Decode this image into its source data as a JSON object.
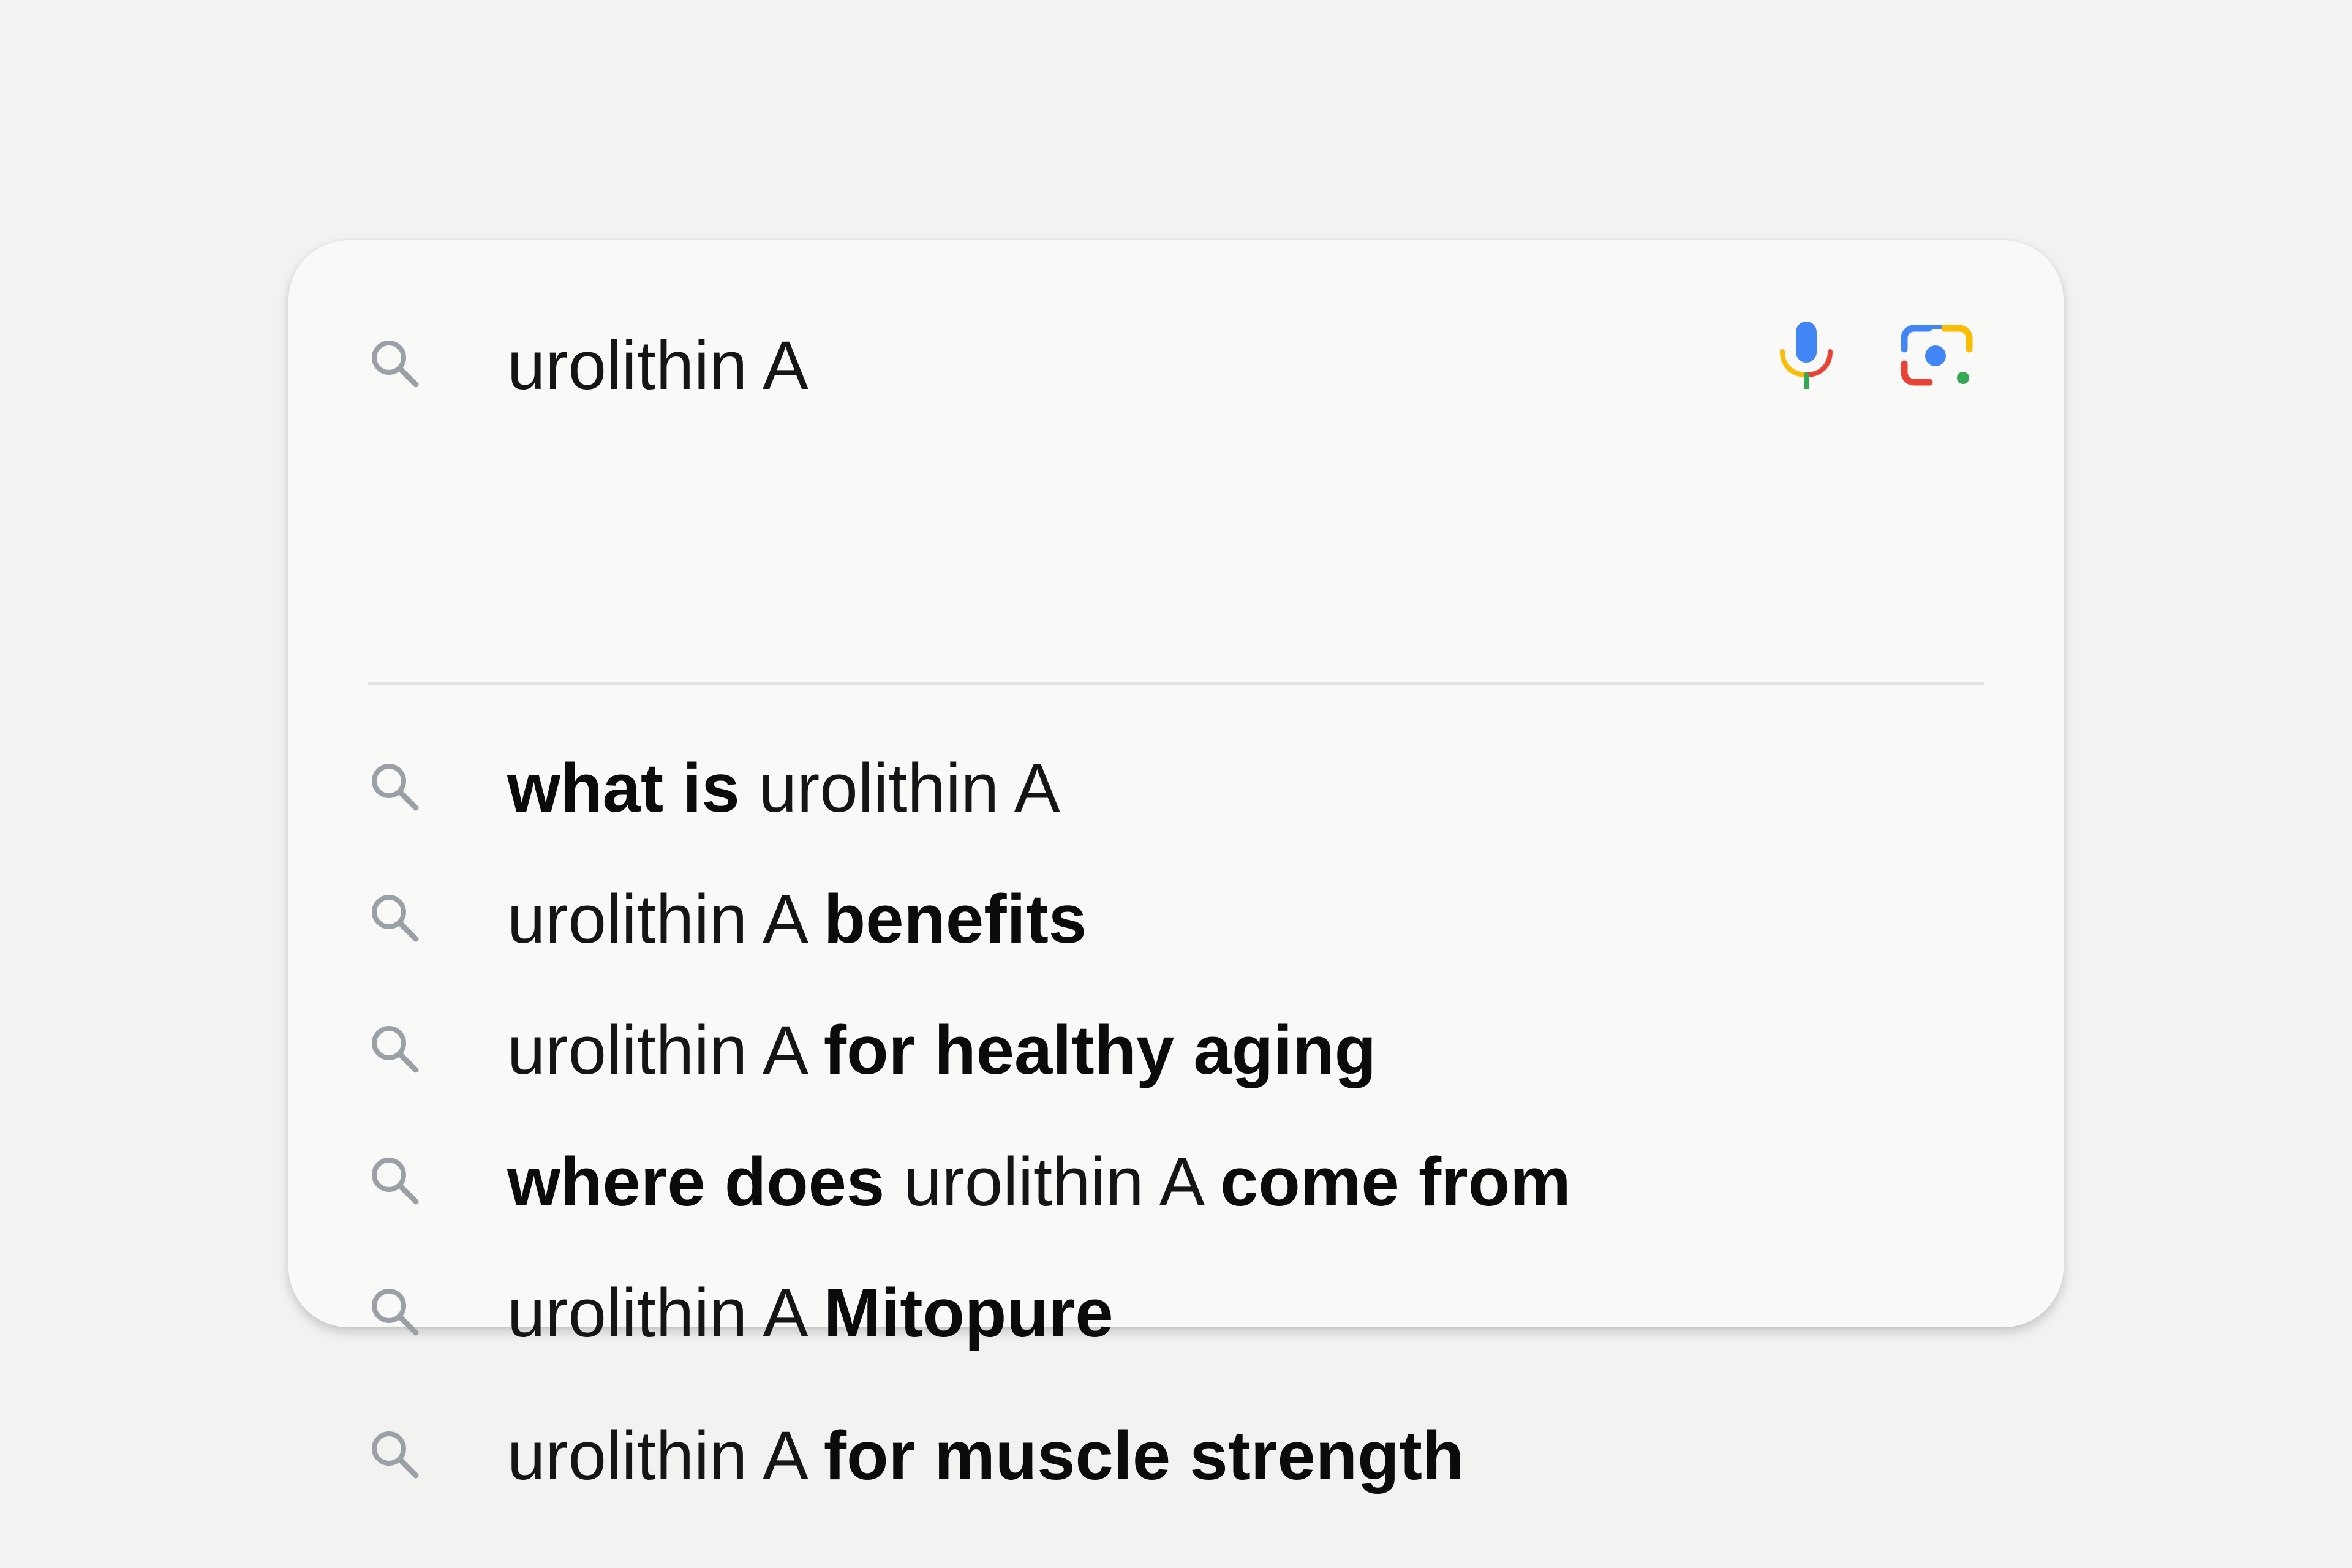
{
  "search": {
    "query": "urolithin A",
    "search_icon": "search-icon",
    "mic_icon": "microphone-icon",
    "lens_icon": "camera-lens-icon"
  },
  "suggestions": [
    {
      "icon": "search-icon",
      "parts": [
        {
          "text": "what is ",
          "bold": true
        },
        {
          "text": "urolithin A",
          "bold": false
        }
      ]
    },
    {
      "icon": "search-icon",
      "parts": [
        {
          "text": "urolithin A ",
          "bold": false
        },
        {
          "text": "benefits",
          "bold": true
        }
      ]
    },
    {
      "icon": "search-icon",
      "parts": [
        {
          "text": "urolithin A ",
          "bold": false
        },
        {
          "text": "for healthy aging",
          "bold": true
        }
      ]
    },
    {
      "icon": "search-icon",
      "parts": [
        {
          "text": "where does ",
          "bold": true
        },
        {
          "text": "urolithin A ",
          "bold": false
        },
        {
          "text": "come from",
          "bold": true
        }
      ]
    },
    {
      "icon": "search-icon",
      "parts": [
        {
          "text": "urolithin A ",
          "bold": false
        },
        {
          "text": "Mitopure",
          "bold": true
        }
      ]
    },
    {
      "icon": "search-icon",
      "parts": [
        {
          "text": "urolithin A ",
          "bold": false
        },
        {
          "text": "for muscle strength",
          "bold": true
        }
      ]
    }
  ],
  "colors": {
    "page_background": "#f2f2f0",
    "card_background": "#f9f9f8",
    "divider": "#e3e3e3",
    "search_icon": "#9aa0a6",
    "google_blue": "#4285f4",
    "google_red": "#ea4335",
    "google_yellow": "#fbbc04",
    "google_green": "#34a853"
  }
}
